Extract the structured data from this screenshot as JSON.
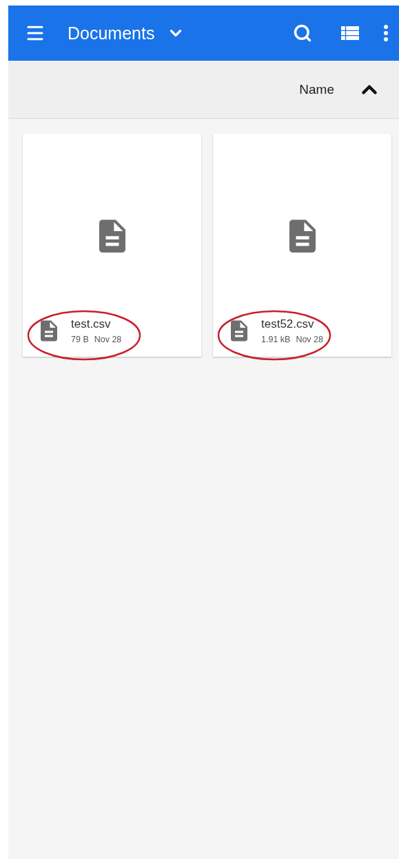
{
  "app_bar": {
    "title": "Documents"
  },
  "sort_bar": {
    "label": "Name"
  },
  "files": [
    {
      "name": "test.csv",
      "size": "79 B",
      "date": "Nov 28",
      "highlighted": true
    },
    {
      "name": "test52.csv",
      "size": "1.91 kB",
      "date": "Nov 28",
      "highlighted": true
    }
  ]
}
